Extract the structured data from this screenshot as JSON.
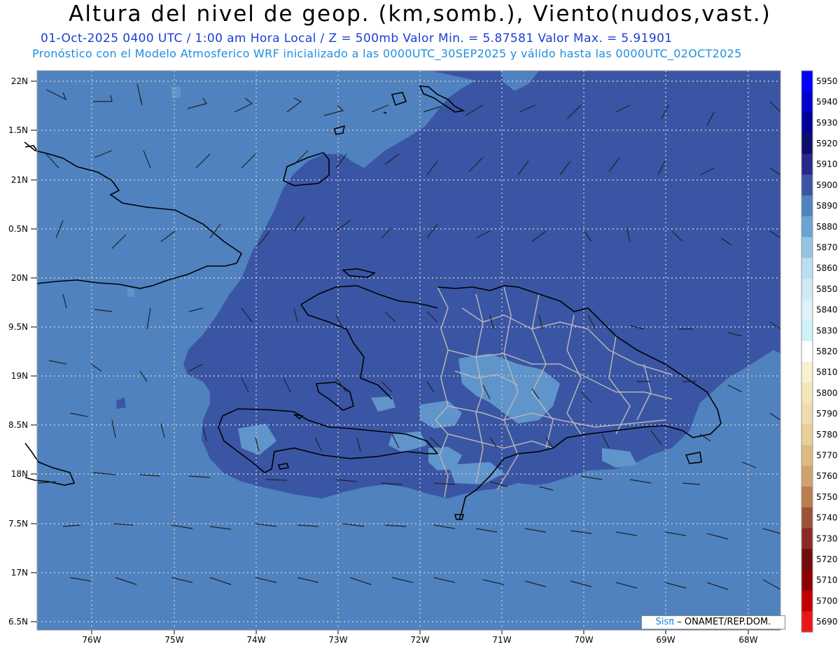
{
  "header": {
    "title": "Altura del nivel de geop. (km,somb.), Viento(nudos,vast.)",
    "info_line": "01-Oct-2025  0400 UTC / 1:00 am Hora Local / Z = 500mb     Valor Min. = 5.87581  Valor Max. = 5.91901",
    "model_line": "Pronóstico con el Modelo Atmosferico WRF inicializado a las 0000UTC_30SEP2025 y válido hasta las  0000UTC_02OCT2025"
  },
  "map": {
    "lat_labels": [
      "22N",
      "1.5N",
      "21N",
      "0.5N",
      "20N",
      "9.5N",
      "19N",
      "8.5N",
      "18N",
      "7.5N",
      "17N",
      "6.5N"
    ],
    "lon_labels": [
      "76W",
      "75W",
      "74W",
      "73W",
      "72W",
      "71W",
      "70W",
      "69W",
      "68W"
    ],
    "fill_colors": {
      "level_5890": "#4f82bf",
      "level_5900": "#3a55a4",
      "level_5880": "#5f95cb"
    },
    "coastline_color": "#000000",
    "province_border_color": "#b8b8b8",
    "wind_barb_color": "#222222"
  },
  "colorbar": {
    "levels": [
      "5950",
      "5940",
      "5930",
      "5920",
      "5910",
      "5900",
      "5890",
      "5880",
      "5870",
      "5860",
      "5850",
      "5840",
      "5830",
      "5820",
      "5810",
      "5800",
      "5790",
      "5780",
      "5770",
      "5760",
      "5750",
      "5740",
      "5730",
      "5720",
      "5710",
      "5700",
      "5690"
    ],
    "colors": [
      "#0000ff",
      "#0000cd",
      "#000099",
      "#0d0d6b",
      "#28288a",
      "#3a55a4",
      "#4f82bf",
      "#6aa3d4",
      "#95c3e3",
      "#b9dff0",
      "#cdeaf5",
      "#dcf1f9",
      "#cdf2f7",
      "#ffffff",
      "#f9f1cd",
      "#f4e6b8",
      "#efdcae",
      "#e8cf9a",
      "#ddbb82",
      "#d0a36c",
      "#b97d50",
      "#9d5238",
      "#8a2a22",
      "#6f0c0c",
      "#8b0000",
      "#c00000",
      "#e81818"
    ]
  },
  "credit": {
    "brand": "Sisπ",
    "rest": "– ONAMET/REP.DOM."
  }
}
